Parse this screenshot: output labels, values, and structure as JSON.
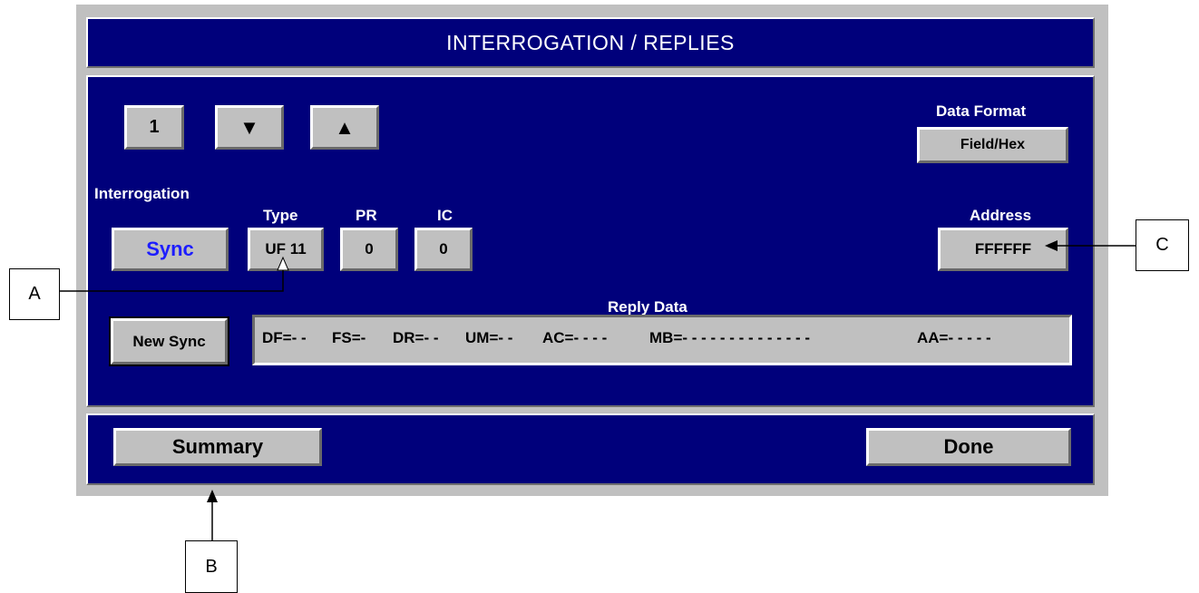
{
  "window": {
    "title": "INTERROGATION / REPLIES"
  },
  "nav": {
    "index_label": "1",
    "down_icon": "triangle-down-icon",
    "up_icon": "triangle-up-icon"
  },
  "data_format": {
    "label": "Data Format",
    "button": "Field/Hex"
  },
  "interrogation": {
    "label": "Interrogation",
    "mode_button": "Sync",
    "mode_color": "#1d1dff",
    "type": {
      "label": "Type",
      "value": "UF 11"
    },
    "pr": {
      "label": "PR",
      "value": "0"
    },
    "ic": {
      "label": "IC",
      "value": "0"
    }
  },
  "address": {
    "label": "Address",
    "value": "FFFFFF"
  },
  "reply": {
    "label": "Reply Data",
    "new_sync_button": "New Sync",
    "fields": [
      "DF=- -",
      "FS=-",
      "DR=- -",
      "UM=- -",
      "AC=- - - -",
      "MB=- - - - - - - - - - - - - -",
      "AA=- - - - -"
    ]
  },
  "footer": {
    "summary_button": "Summary",
    "done_button": "Done"
  },
  "callouts": {
    "a": "A",
    "b": "B",
    "c": "C"
  },
  "colors": {
    "panel": "#00007b",
    "frame": "#c0c0c0"
  }
}
